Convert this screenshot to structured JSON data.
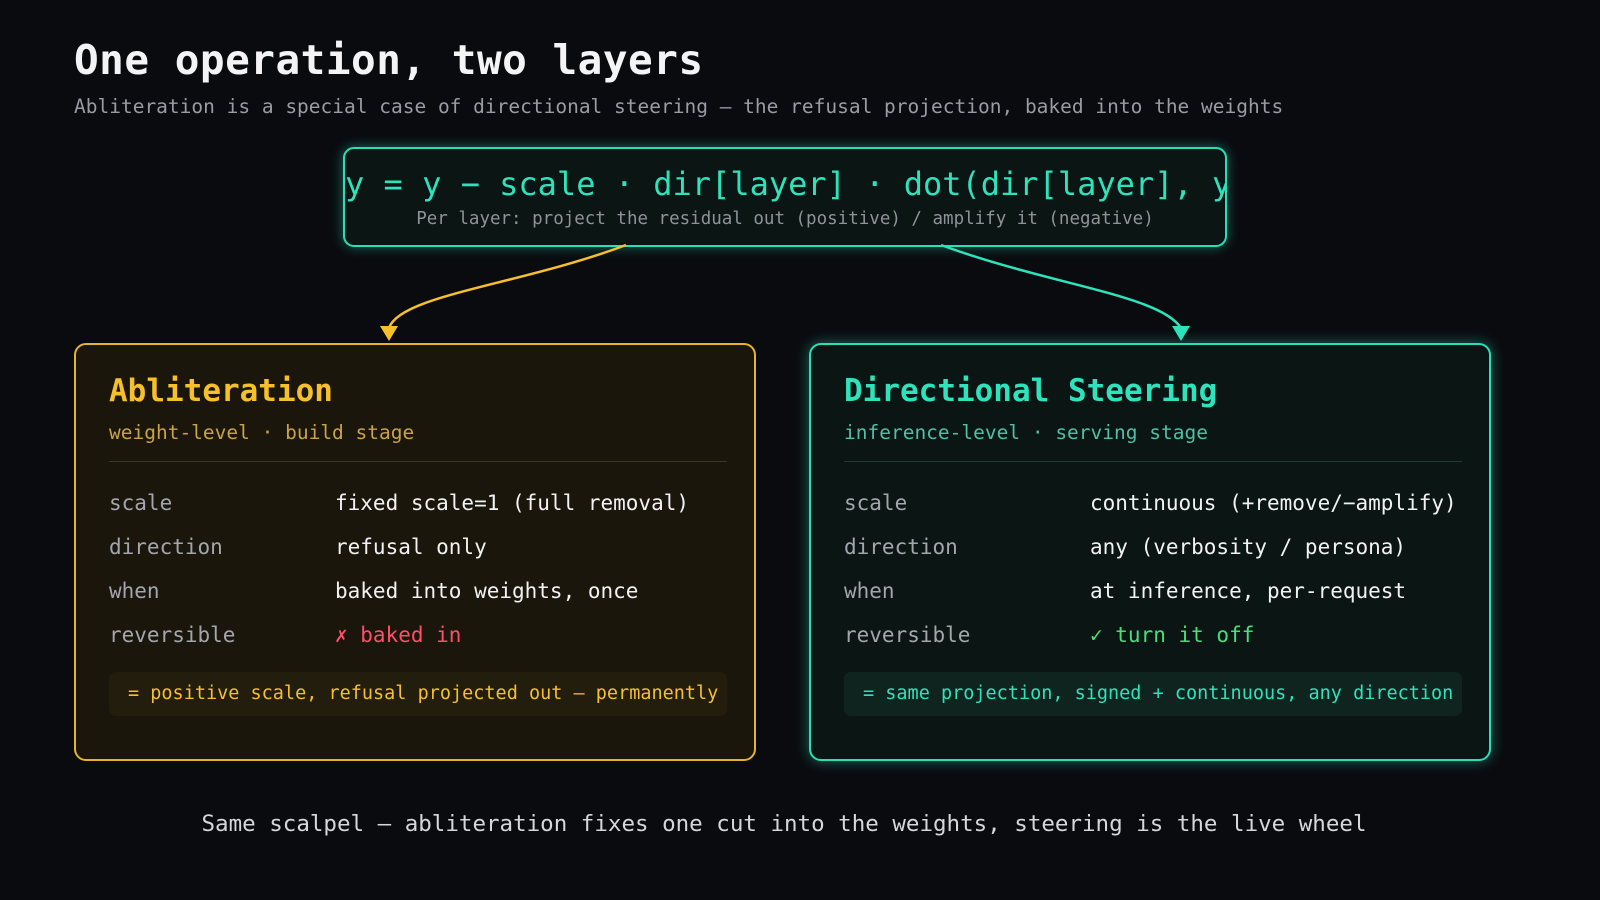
{
  "title": "One operation, two layers",
  "subtitle": "Abliteration is a special case of directional steering — the refusal projection, baked into the weights",
  "formula": {
    "expression": "y = y − scale · dir[layer] · dot(dir[layer], y)",
    "caption": "Per layer: project the residual out (positive) / amplify it (negative)"
  },
  "colors": {
    "background": "#0a0b0f",
    "abliteration": "#f6c02b",
    "steering": "#2de3bb",
    "negative": "#ff4d6a",
    "positive": "#45e07a"
  },
  "abliteration": {
    "title": "Abliteration",
    "subtitle": "weight-level · build stage",
    "rows": [
      {
        "key": "scale",
        "value": "fixed scale=1 (full removal)"
      },
      {
        "key": "direction",
        "value": "refusal only"
      },
      {
        "key": "when",
        "value": "baked into weights, once"
      },
      {
        "key": "reversible",
        "value": "✗ baked in"
      }
    ],
    "note": "= positive scale, refusal projected out — permanently"
  },
  "steering": {
    "title": "Directional Steering",
    "subtitle": "inference-level · serving stage",
    "rows": [
      {
        "key": "scale",
        "value": "continuous (+remove/−amplify)"
      },
      {
        "key": "direction",
        "value": "any (verbosity / persona)"
      },
      {
        "key": "when",
        "value": "at inference, per-request"
      },
      {
        "key": "reversible",
        "value": "✓ turn it off"
      }
    ],
    "note": "= same projection, signed + continuous, any direction"
  },
  "footer": "Same scalpel — abliteration fixes one cut into the weights, steering is the live wheel"
}
